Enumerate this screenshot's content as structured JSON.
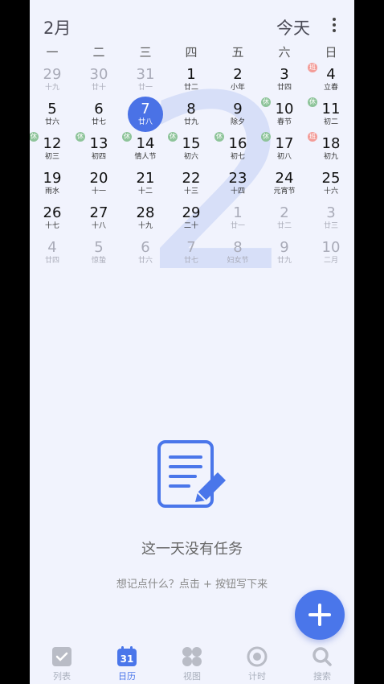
{
  "header": {
    "month": "2月",
    "today_label": "今天"
  },
  "watermark": "2",
  "weekdays": [
    "一",
    "二",
    "三",
    "四",
    "五",
    "六",
    "日"
  ],
  "calendar": {
    "weeks": [
      [
        {
          "day": "29",
          "lunar": "十九",
          "out": true
        },
        {
          "day": "30",
          "lunar": "廿十",
          "out": true
        },
        {
          "day": "31",
          "lunar": "廿一",
          "out": true
        },
        {
          "day": "1",
          "lunar": "廿二"
        },
        {
          "day": "2",
          "lunar": "小年"
        },
        {
          "day": "3",
          "lunar": "廿四"
        },
        {
          "day": "4",
          "lunar": "立春",
          "tag": "班",
          "tag_type": "work"
        }
      ],
      [
        {
          "day": "5",
          "lunar": "廿六"
        },
        {
          "day": "6",
          "lunar": "廿七"
        },
        {
          "day": "7",
          "lunar": "廿八",
          "selected": true
        },
        {
          "day": "8",
          "lunar": "廿九"
        },
        {
          "day": "9",
          "lunar": "除夕"
        },
        {
          "day": "10",
          "lunar": "春节",
          "tag": "休",
          "tag_type": "rest"
        },
        {
          "day": "11",
          "lunar": "初二",
          "tag": "休",
          "tag_type": "rest"
        }
      ],
      [
        {
          "day": "12",
          "lunar": "初三",
          "tag": "休",
          "tag_type": "rest"
        },
        {
          "day": "13",
          "lunar": "初四",
          "tag": "休",
          "tag_type": "rest"
        },
        {
          "day": "14",
          "lunar": "情人节",
          "tag": "休",
          "tag_type": "rest"
        },
        {
          "day": "15",
          "lunar": "初六",
          "tag": "休",
          "tag_type": "rest"
        },
        {
          "day": "16",
          "lunar": "初七",
          "tag": "休",
          "tag_type": "rest"
        },
        {
          "day": "17",
          "lunar": "初八",
          "tag": "休",
          "tag_type": "rest"
        },
        {
          "day": "18",
          "lunar": "初九",
          "tag": "班",
          "tag_type": "work"
        }
      ],
      [
        {
          "day": "19",
          "lunar": "雨水"
        },
        {
          "day": "20",
          "lunar": "十一"
        },
        {
          "day": "21",
          "lunar": "十二"
        },
        {
          "day": "22",
          "lunar": "十三"
        },
        {
          "day": "23",
          "lunar": "十四"
        },
        {
          "day": "24",
          "lunar": "元宵节"
        },
        {
          "day": "25",
          "lunar": "十六"
        }
      ],
      [
        {
          "day": "26",
          "lunar": "十七"
        },
        {
          "day": "27",
          "lunar": "十八"
        },
        {
          "day": "28",
          "lunar": "十九"
        },
        {
          "day": "29",
          "lunar": "二十"
        },
        {
          "day": "1",
          "lunar": "廿一",
          "out": true
        },
        {
          "day": "2",
          "lunar": "廿二",
          "out": true
        },
        {
          "day": "3",
          "lunar": "廿三",
          "out": true
        }
      ],
      [
        {
          "day": "4",
          "lunar": "廿四",
          "out": true
        },
        {
          "day": "5",
          "lunar": "惊蛰",
          "out": true
        },
        {
          "day": "6",
          "lunar": "廿六",
          "out": true
        },
        {
          "day": "7",
          "lunar": "廿七",
          "out": true
        },
        {
          "day": "8",
          "lunar": "妇女节",
          "out": true
        },
        {
          "day": "9",
          "lunar": "廿九",
          "out": true
        },
        {
          "day": "10",
          "lunar": "二月",
          "out": true
        }
      ]
    ]
  },
  "empty_state": {
    "title": "这一天没有任务",
    "hint": "想记点什么？点击 + 按钮写下来"
  },
  "tabs": [
    {
      "label": "列表",
      "icon": "checkbox-icon"
    },
    {
      "label": "日历",
      "icon": "calendar-icon",
      "badge": "31",
      "active": true
    },
    {
      "label": "视图",
      "icon": "grid-icon"
    },
    {
      "label": "计时",
      "icon": "timer-icon"
    },
    {
      "label": "搜索",
      "icon": "search-icon"
    }
  ],
  "colors": {
    "accent": "#4a76ea",
    "background": "#f1f3fd",
    "rest_tag": "#8ec49a",
    "work_tag": "#f39c98"
  }
}
